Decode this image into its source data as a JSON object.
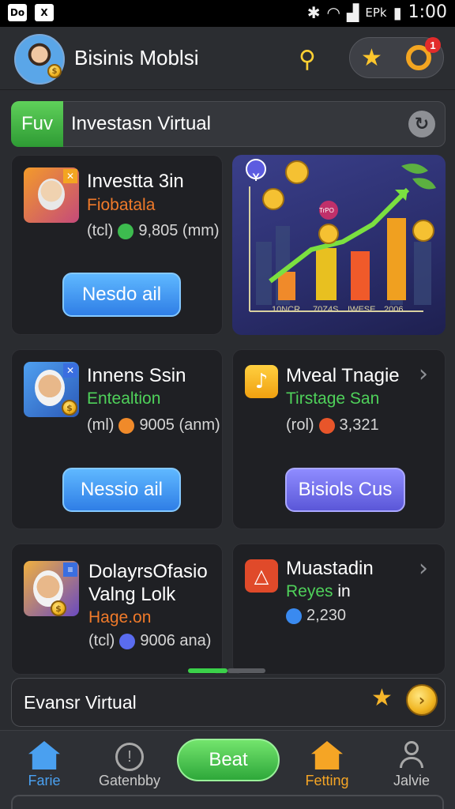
{
  "status_bar": {
    "left_icons": [
      "Do",
      "X"
    ],
    "battery_text": "EPk",
    "time": "1:00"
  },
  "app_bar": {
    "title": "Bisinis Moblsi",
    "notification_badge": "1",
    "icons": [
      "avatar",
      "search-icon",
      "star-icon",
      "ring-icon"
    ]
  },
  "banner": {
    "tag": "Fuv",
    "text": "Investasn Virtual"
  },
  "cards": [
    {
      "title": "Investta 3in",
      "subtitle": "Fiobatala",
      "stat_prefix": "(tcl)",
      "stat_value": "9,805 (mm)",
      "button": "Nesdo ail",
      "subtitle_color": "#f07a2a",
      "dot_color": "#3dbb4f"
    },
    {
      "title": "Innens Ssin",
      "subtitle": "Entealtion",
      "stat_prefix": "(ml)",
      "stat_value": "9005 (anm)",
      "button": "Nessio ail",
      "subtitle_color": "#4fd15a",
      "dot_color": "#f08a2a"
    },
    {
      "title": "Mveal Tnagie",
      "subtitle": "Tirstage San",
      "stat_prefix": "(rol)",
      "stat_value": "3,321",
      "button": "Bisiols Cus",
      "subtitle_color": "#4fd15a",
      "dot_color": "#e8552a"
    },
    {
      "title_line1": "DolayrsOfasio",
      "title_line2": "Valng Lolk",
      "subtitle": "Hage.on",
      "stat_prefix": "(tcl)",
      "stat_value": "9006 ana)",
      "subtitle_color": "#f07a2a",
      "dot_color": "#5a6cf0"
    },
    {
      "title": "Muastadin",
      "subtitle_part1": "Reyes",
      "subtitle_part2": "in",
      "stat_value": "2,230",
      "subtitle_color": "#4fd15a",
      "dot_color": "#3a8af0"
    }
  ],
  "chart_card": {
    "labels": [
      "10NCR",
      "70Z4S",
      "IWESE",
      "2006"
    ],
    "stamp": "TrPO",
    "badge": "Y"
  },
  "bottom_input": {
    "text": "Evansr Virtual"
  },
  "nav": {
    "items": [
      "Farie",
      "Gatenbby",
      "Beat",
      "Fetting",
      "Jalvie"
    ]
  },
  "colors": {
    "accent_green": "#3bd14a",
    "accent_orange": "#f3a521",
    "accent_blue": "#3f8ef0",
    "background": "#2a2c30",
    "card": "#1f2024"
  }
}
